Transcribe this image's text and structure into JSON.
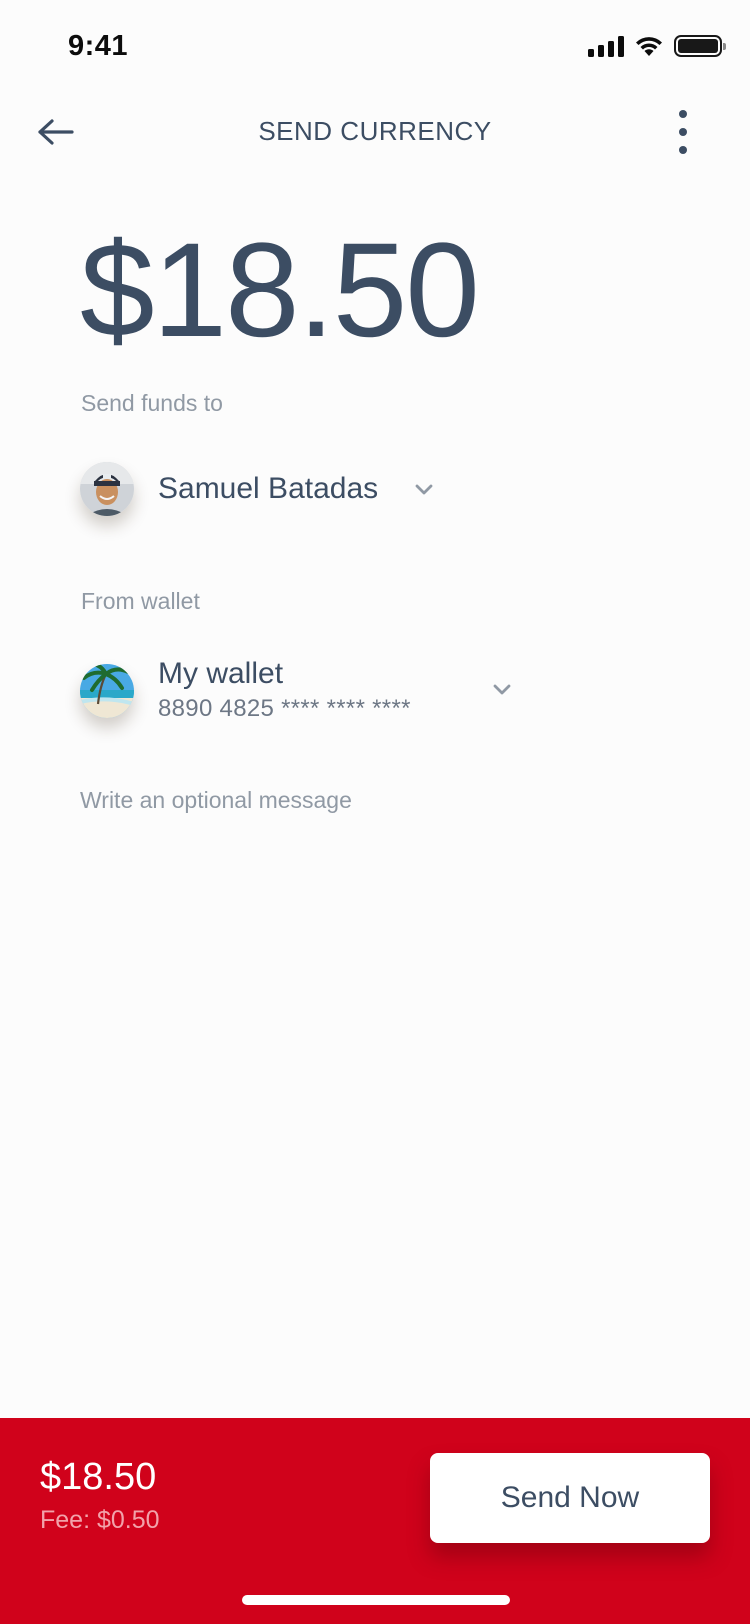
{
  "status_bar": {
    "time": "9:41"
  },
  "nav": {
    "title": "SEND CURRENCY"
  },
  "amount": "$18.50",
  "recipient": {
    "section_label": "Send funds to",
    "name": "Samuel Batadas"
  },
  "wallet": {
    "section_label": "From wallet",
    "title": "My wallet",
    "number": "8890 4825 **** **** ****"
  },
  "message": {
    "placeholder": "Write an optional message",
    "value": ""
  },
  "footer": {
    "total": "$18.50",
    "fee": "Fee: $0.50",
    "send_label": "Send Now"
  },
  "colors": {
    "accent": "#d0021b",
    "text_primary": "#3c4d63",
    "text_secondary": "#9099a4",
    "background": "#fcfcfc"
  },
  "icons": [
    "back-arrow-icon",
    "more-vertical-icon",
    "chevron-down-icon",
    "signal-icon",
    "wifi-icon",
    "battery-icon"
  ]
}
